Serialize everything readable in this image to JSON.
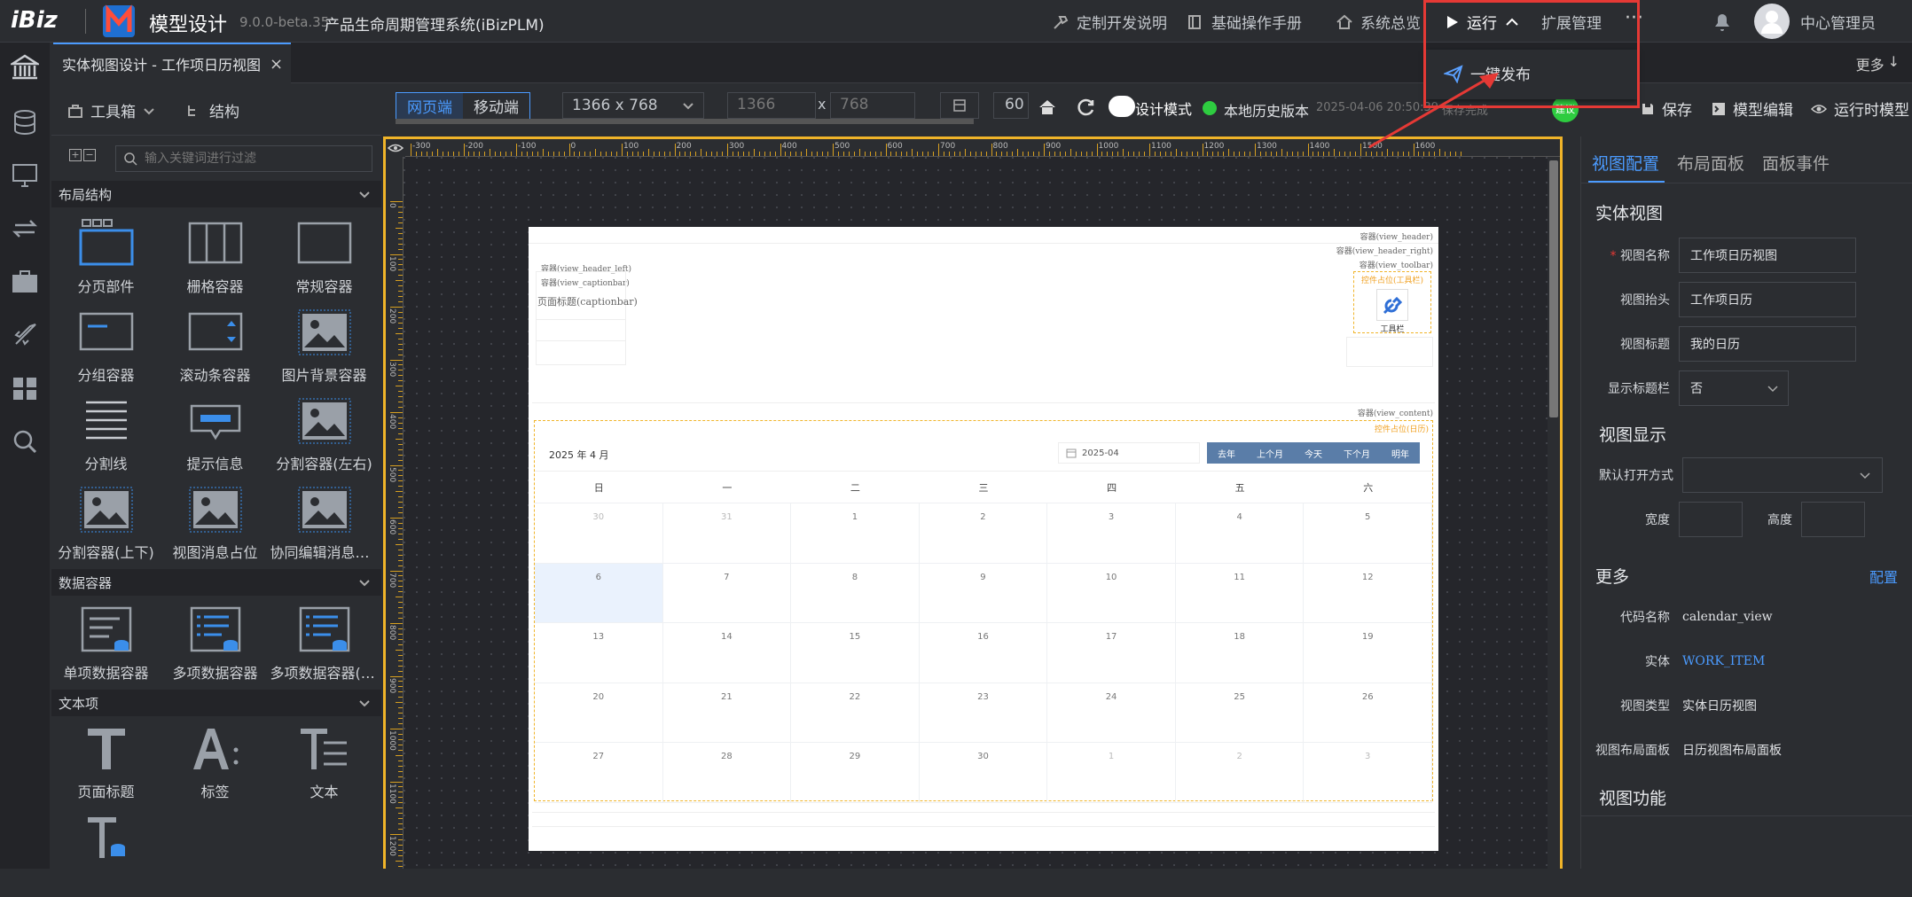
{
  "topbar": {
    "logo": "iBiz",
    "app_title": "模型设计",
    "version": "9.0.0-beta.35",
    "system_name": "产品生命周期管理系统(iBizPLM)",
    "links": [
      "定制开发说明",
      "基础操作手册",
      "系统总览"
    ],
    "run_label": "运行",
    "ext_label": "扩展管理",
    "more_label": "···",
    "user_name": "中心管理员"
  },
  "run_menu": {
    "publish_label": "一键发布"
  },
  "tabs": {
    "active_tab": "实体视图设计 - 工作项日历视图",
    "more_label": "更多"
  },
  "toolbox": {
    "tab_toolbox": "工具箱",
    "tab_structure": "结构",
    "search_placeholder": "输入关键词进行过滤",
    "sections": {
      "layout": {
        "title": "布局结构",
        "items": [
          "分页部件",
          "栅格容器",
          "常规容器",
          "分组容器",
          "滚动条容器",
          "图片背景容器",
          "分割线",
          "提示信息",
          "分割容器(左右)",
          "分割容器(上下)",
          "视图消息占位",
          "协同编辑消息占位"
        ]
      },
      "data": {
        "title": "数据容器",
        "items": [
          "单项数据容器",
          "多项数据容器",
          "多项数据容器(分页)"
        ]
      },
      "text": {
        "title": "文本项",
        "items": [
          "页面标题",
          "标签",
          "文本"
        ]
      }
    }
  },
  "designer_toolbar": {
    "web": "网页端",
    "mobile": "移动端",
    "resolution": "1366 x 768",
    "width_value": "1366",
    "height_value": "768",
    "x_label": "x",
    "zoom_value": "60",
    "design_mode": "设计模式",
    "history_label": "本地历史版本",
    "history_time": "2025-04-06 20:50:39",
    "history_status": "保存完成",
    "build_label": "建议",
    "save_label": "保存",
    "model_edit_label": "模型编辑",
    "runtime_label": "运行时模型"
  },
  "ruler": {
    "ticks": [
      "-300",
      "-200",
      "-100",
      "0",
      "100",
      "200",
      "300",
      "400",
      "500",
      "600",
      "700",
      "800",
      "900",
      "1000",
      "1100",
      "1200",
      "1300",
      "1400",
      "1500",
      "1600"
    ]
  },
  "vruler": {
    "ticks": [
      "0",
      "100",
      "200",
      "300",
      "400",
      "500",
      "600",
      "700",
      "800",
      "900",
      "1000",
      "1100",
      "1200"
    ]
  },
  "page_view": {
    "container_header": "容器(view_header)",
    "container_header_right": "容器(view_header_right)",
    "container_toolbar": "容器(view_toolbar)",
    "toolbar_placeholder": "控件占位(工具栏)",
    "toolbar_label": "工具栏",
    "container_header_left": "容器(view_header_left)",
    "container_captionbar": "容器(view_captionbar)",
    "page_caption": "页面标题(captionbar)",
    "container_content": "容器(view_content)",
    "calendar_placeholder": "控件占位(日历)",
    "calendar": {
      "title": "2025 年 4 月",
      "date_input": "2025-04",
      "buttons": [
        "去年",
        "上个月",
        "今天",
        "下个月",
        "明年"
      ],
      "weekdays": [
        "日",
        "一",
        "二",
        "三",
        "四",
        "五",
        "六"
      ],
      "weeks": [
        [
          "30",
          "31",
          "1",
          "2",
          "3",
          "4",
          "5"
        ],
        [
          "6",
          "7",
          "8",
          "9",
          "10",
          "11",
          "12"
        ],
        [
          "13",
          "14",
          "15",
          "16",
          "17",
          "18",
          "19"
        ],
        [
          "20",
          "21",
          "22",
          "23",
          "24",
          "25",
          "26"
        ],
        [
          "27",
          "28",
          "29",
          "30",
          "1",
          "2",
          "3"
        ]
      ]
    }
  },
  "right_panel": {
    "tabs": [
      "视图配置",
      "布局面板",
      "面板事件"
    ],
    "entity_view": "实体视图",
    "view_name_label": "视图名称",
    "view_name": "工作项日历视图",
    "view_header_label": "视图抬头",
    "view_header": "工作项日历",
    "view_title_label": "视图标题",
    "view_title": "我的日历",
    "show_titlebar_label": "显示标题栏",
    "show_titlebar": "否",
    "view_display": "视图显示",
    "open_mode_label": "默认打开方式",
    "width_label": "宽度",
    "height_label": "高度",
    "more": "更多",
    "config_link": "配置",
    "code_name_label": "代码名称",
    "code_name": "calendar_view",
    "entity_label": "实体",
    "entity": "WORK_ITEM",
    "view_type_label": "视图类型",
    "view_type": "实体日历视图",
    "layout_panel_label": "视图布局面板",
    "layout_panel": "日历视图布局面板",
    "view_function": "视图功能"
  },
  "colors": {
    "accent": "#4b9bff",
    "highlight_border": "#e53935",
    "canvas_border": "#f0b429",
    "cal_button": "#5a7da8"
  }
}
